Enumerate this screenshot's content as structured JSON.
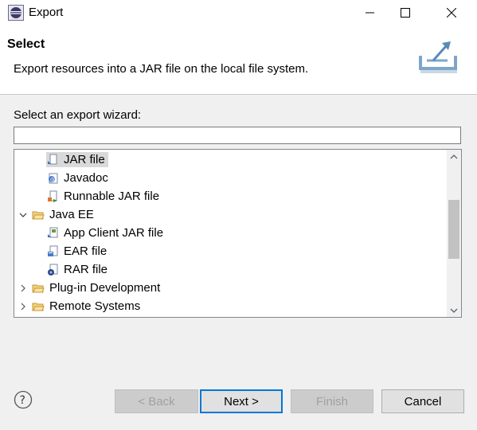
{
  "window": {
    "title": "Export",
    "controls": {
      "minimize": "minimize-icon",
      "maximize": "maximize-icon",
      "close": "close-icon"
    }
  },
  "banner": {
    "title": "Select",
    "description": "Export resources into a JAR file on the local file system.",
    "icon": "export-tray-icon"
  },
  "wizard": {
    "label": "Select an export wizard:",
    "filter_value": "",
    "tree": [
      {
        "label": "JAR file",
        "icon": "jar-file-icon",
        "level": 2,
        "selected": true
      },
      {
        "label": "Javadoc",
        "icon": "javadoc-icon",
        "level": 2
      },
      {
        "label": "Runnable JAR file",
        "icon": "runnable-jar-icon",
        "level": 2
      },
      {
        "label": "Java EE",
        "icon": "folder-open-icon",
        "level": 1,
        "expanded": true
      },
      {
        "label": "App Client JAR file",
        "icon": "app-client-jar-icon",
        "level": 2
      },
      {
        "label": "EAR file",
        "icon": "ear-file-icon",
        "level": 2
      },
      {
        "label": "RAR file",
        "icon": "rar-file-icon",
        "level": 2
      },
      {
        "label": "Plug-in Development",
        "icon": "folder-open-icon",
        "level": 1,
        "expanded": false
      },
      {
        "label": "Remote Systems",
        "icon": "folder-open-icon",
        "level": 1,
        "expanded": false
      }
    ]
  },
  "buttons": {
    "back": "< Back",
    "next": "Next >",
    "finish": "Finish",
    "cancel": "Cancel"
  },
  "colors": {
    "accent": "#0078d7",
    "folder": "#e8b84a"
  }
}
